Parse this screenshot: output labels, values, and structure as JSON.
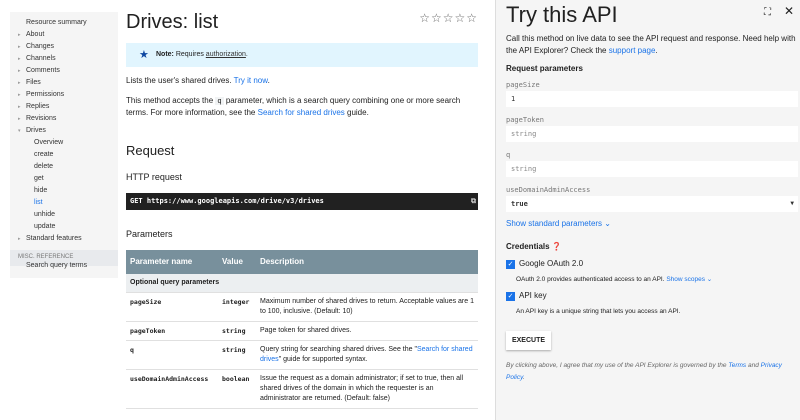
{
  "sidebar": {
    "items": [
      {
        "label": "Resource summary",
        "arrow": ""
      },
      {
        "label": "About",
        "arrow": "▸"
      },
      {
        "label": "Changes",
        "arrow": "▸"
      },
      {
        "label": "Channels",
        "arrow": "▸"
      },
      {
        "label": "Comments",
        "arrow": "▸"
      },
      {
        "label": "Files",
        "arrow": "▸"
      },
      {
        "label": "Permissions",
        "arrow": "▸"
      },
      {
        "label": "Replies",
        "arrow": "▸"
      },
      {
        "label": "Revisions",
        "arrow": "▸"
      },
      {
        "label": "Drives",
        "arrow": "▾"
      }
    ],
    "subitems": [
      "Overview",
      "create",
      "delete",
      "get",
      "hide",
      "list",
      "unhide",
      "update"
    ],
    "active": "list",
    "standard": "Standard features",
    "misc_heading": "MISC. REFERENCE",
    "misc_item": "Search query terms"
  },
  "main": {
    "title": "Drives: list",
    "stars": "☆☆☆☆☆",
    "note_label": "Note:",
    "note_text": " Requires ",
    "note_link": "authorization",
    "note_end": ".",
    "intro": "Lists the user's shared drives. ",
    "intro_link": "Try it now",
    "p2a": "This method accepts the ",
    "p2code": "q",
    "p2b": " parameter, which is a search query combining one or more search terms. For more information, see the ",
    "p2link": "Search for shared drives",
    "p2c": " guide.",
    "request_heading": "Request",
    "http_heading": "HTTP request",
    "http_code": "GET https://www.googleapis.com/drive/v3/drives",
    "params_heading": "Parameters",
    "table": {
      "headers": [
        "Parameter name",
        "Value",
        "Description"
      ],
      "group": "Optional query parameters",
      "rows": [
        {
          "name": "pageSize",
          "type": "integer",
          "desc": "Maximum number of shared drives to return. Acceptable values are 1 to 100, inclusive. (Default: 10)"
        },
        {
          "name": "pageToken",
          "type": "string",
          "desc": "Page token for shared drives."
        },
        {
          "name": "q",
          "type": "string",
          "desc_a": "Query string for searching shared drives. See the \"",
          "desc_link": "Search for shared drives",
          "desc_b": "\" guide for supported syntax."
        },
        {
          "name": "useDomainAdminAccess",
          "type": "boolean",
          "desc": "Issue the request as a domain administrator; if set to true, then all shared drives of the domain in which the requester is an administrator are returned. (Default: false)"
        }
      ]
    }
  },
  "panel": {
    "title": "Try this API",
    "desc": "Call this method on live data to see the API request and response. Need help with the API Explorer? Check the ",
    "desc_link": "support page",
    "desc_end": ".",
    "req_heading": "Request parameters",
    "fields": [
      {
        "label": "pageSize",
        "value": "1",
        "placeholder": ""
      },
      {
        "label": "pageToken",
        "value": "",
        "placeholder": "string"
      },
      {
        "label": "q",
        "value": "",
        "placeholder": "string"
      },
      {
        "label": "useDomainAdminAccess",
        "value": "true",
        "placeholder": ""
      }
    ],
    "show_std": "Show standard parameters ⌄",
    "cred_heading": "Credentials",
    "oauth_label": "Google OAuth 2.0",
    "oauth_desc": "OAuth 2.0 provides authenticated access to an API. ",
    "oauth_link": "Show scopes ⌄",
    "apikey_label": "API key",
    "apikey_desc": "An API key is a unique string that lets you access an API.",
    "execute": "EXECUTE",
    "terms_a": "By clicking above, I agree that my use of the API Explorer is governed by the ",
    "terms_link": "Terms",
    "terms_b": " and ",
    "privacy_link": "Privacy Policy",
    "terms_c": "."
  }
}
